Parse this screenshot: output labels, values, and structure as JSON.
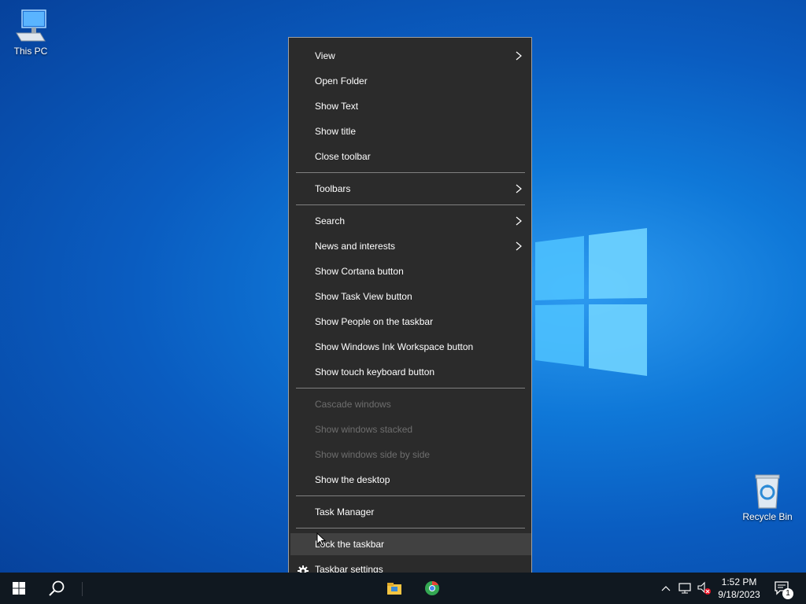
{
  "desktop": {
    "icons": [
      {
        "label": "This PC",
        "icon": "computer-icon"
      },
      {
        "label": "Recycle Bin",
        "icon": "recycle-bin-icon"
      }
    ]
  },
  "context_menu": {
    "items": [
      {
        "label": "View",
        "submenu": true,
        "enabled": true
      },
      {
        "label": "Open Folder",
        "submenu": false,
        "enabled": true
      },
      {
        "label": "Show Text",
        "submenu": false,
        "enabled": true
      },
      {
        "label": "Show title",
        "submenu": false,
        "enabled": true
      },
      {
        "label": "Close toolbar",
        "submenu": false,
        "enabled": true
      },
      {
        "label": "Toolbars",
        "submenu": true,
        "enabled": true
      },
      {
        "label": "Search",
        "submenu": true,
        "enabled": true
      },
      {
        "label": "News and interests",
        "submenu": true,
        "enabled": true
      },
      {
        "label": "Show Cortana button",
        "submenu": false,
        "enabled": true
      },
      {
        "label": "Show Task View button",
        "submenu": false,
        "enabled": true
      },
      {
        "label": "Show People on the taskbar",
        "submenu": false,
        "enabled": true
      },
      {
        "label": "Show Windows Ink Workspace button",
        "submenu": false,
        "enabled": true
      },
      {
        "label": "Show touch keyboard button",
        "submenu": false,
        "enabled": true
      },
      {
        "label": "Cascade windows",
        "submenu": false,
        "enabled": false
      },
      {
        "label": "Show windows stacked",
        "submenu": false,
        "enabled": false
      },
      {
        "label": "Show windows side by side",
        "submenu": false,
        "enabled": false
      },
      {
        "label": "Show the desktop",
        "submenu": false,
        "enabled": true
      },
      {
        "label": "Task Manager",
        "submenu": false,
        "enabled": true
      },
      {
        "label": "Lock the taskbar",
        "submenu": false,
        "enabled": true,
        "hovered": true
      },
      {
        "label": "Taskbar settings",
        "submenu": false,
        "enabled": true,
        "icon": "gear-icon"
      }
    ]
  },
  "taskbar": {
    "start_icon": "windows-start-icon",
    "search_icon": "search-icon",
    "pinned": [
      "file-explorer-icon",
      "chrome-icon"
    ],
    "tray": {
      "icons": [
        "chevron-up-icon",
        "network-icon",
        "volume-muted-icon"
      ],
      "time": "1:52 PM",
      "date": "9/18/2023",
      "notification_count": "1"
    }
  },
  "colors": {
    "menu_bg": "#2b2b2b",
    "menu_hover": "#414141",
    "menu_disabled": "#6e6e6e",
    "taskbar_bg": "#101820",
    "desktop_blue": "#0a5cc0"
  }
}
